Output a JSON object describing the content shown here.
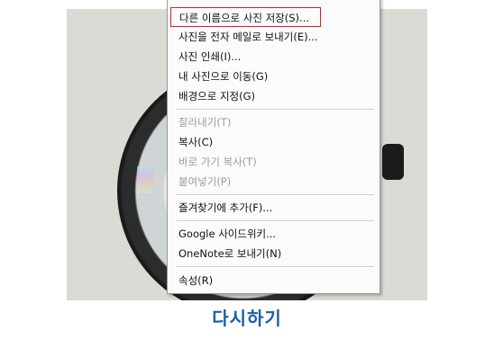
{
  "menu": {
    "items": [
      {
        "label": "다른 이름으로 사진 저장(S)...",
        "enabled": true,
        "highlighted": true
      },
      {
        "label": "사진을 전자 메일로 보내기(E)...",
        "enabled": true
      },
      {
        "label": "사진 인쇄(I)...",
        "enabled": true
      },
      {
        "label": "내 사진으로 이동(G)",
        "enabled": true
      },
      {
        "label": "배경으로 지정(G)",
        "enabled": true
      },
      {
        "label": "잘라내기(T)",
        "enabled": false
      },
      {
        "label": "복사(C)",
        "enabled": true
      },
      {
        "label": "바로 가기 복사(T)",
        "enabled": false
      },
      {
        "label": "붙여넣기(P)",
        "enabled": false
      },
      {
        "label": "즐겨찾기에 추가(F)...",
        "enabled": true
      },
      {
        "label": "Google 사이드위키...",
        "enabled": true
      },
      {
        "label": "OneNote로 보내기(N)",
        "enabled": true
      },
      {
        "label": "속성(R)",
        "enabled": true
      }
    ]
  },
  "caption": "다시하기",
  "colors": {
    "caption": "#1b5fa8",
    "highlight_border": "#d02020"
  }
}
